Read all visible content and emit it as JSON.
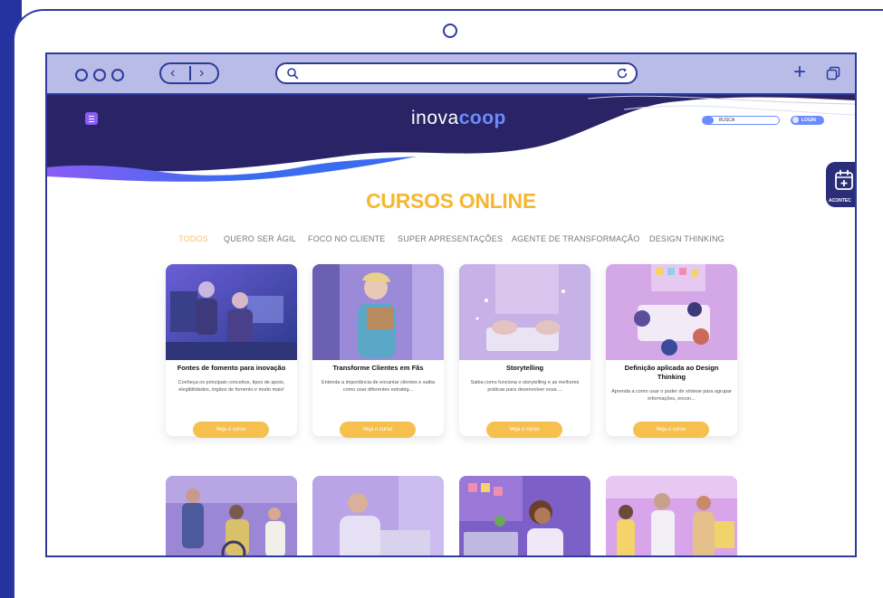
{
  "site": {
    "logo_left": "inova",
    "logo_right": "coop",
    "search_placeholder": "BUSCA",
    "login_label": "LOGIN",
    "float_label": "ACONTEC"
  },
  "page_title": "CURSOS ONLINE",
  "categories": [
    {
      "label": "TODOS",
      "active": true
    },
    {
      "label": "QUERO SER ÁGIL",
      "active": false
    },
    {
      "label": "FOCO NO CLIENTE",
      "active": false
    },
    {
      "label": "SUPER APRESENTAÇÕES",
      "active": false
    },
    {
      "label": "AGENTE DE TRANSFORMAÇÃO",
      "active": false
    },
    {
      "label": "DESIGN THINKING",
      "active": false
    }
  ],
  "courses": [
    {
      "title": "Fontes de fomento para inovação",
      "desc": "Conheça os principais conceitos, tipos de apoio, elegibilidades, órgãos de fomento e muito mais!",
      "cta": "Veja o curso"
    },
    {
      "title": "Transforme Clientes em Fãs",
      "desc": "Entenda a importância de encantar clientes e saiba como usar diferentes estratég...",
      "cta": "Veja o curso"
    },
    {
      "title": "Storytelling",
      "desc": "Saiba como funciona o storytelling e as melhores práticas para desenvolver essa ...",
      "cta": "Veja o curso"
    },
    {
      "title": "Definição aplicada ao Design Thinking",
      "desc": "Aprenda a como usar o poder de síntese para agrupar informações, encon...",
      "cta": "Veja o curso"
    }
  ],
  "colors": {
    "frame": "#2d3b9c",
    "hero": "#2a2466",
    "accent": "#f5b731",
    "button": "#f5c04e",
    "link_blue": "#6b8cff"
  }
}
